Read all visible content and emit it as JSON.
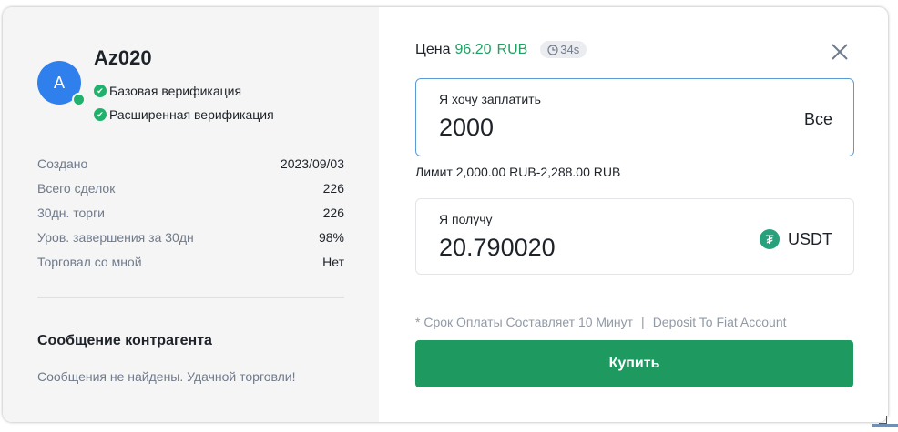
{
  "counterparty": {
    "avatar_letter": "A",
    "username": "Az020",
    "verifications": [
      "Базовая верификация",
      "Расширенная верификация"
    ]
  },
  "stats": [
    {
      "label": "Создано",
      "value": "2023/09/03"
    },
    {
      "label": "Всего сделок",
      "value": "226"
    },
    {
      "label": "30дн. торги",
      "value": "226"
    },
    {
      "label": "Уров. завершения за 30дн",
      "value": "98%"
    },
    {
      "label": "Торговал со мной",
      "value": "Нет"
    }
  ],
  "message": {
    "title": "Сообщение контрагента",
    "text": "Сообщения не найдены. Удачной торговли!"
  },
  "price": {
    "label": "Цена",
    "value": "96.20",
    "currency": "RUB",
    "timer": "34s"
  },
  "pay": {
    "label": "Я хочу заплатить",
    "value": "2000",
    "all_label": "Все"
  },
  "limit_text": "Лимит 2,000.00 RUB-2,288.00 RUB",
  "receive": {
    "label": "Я получу",
    "value": "20.790020",
    "coin": "USDT"
  },
  "note": {
    "payment_term": "* Срок Оплаты Составляет 10 Минут",
    "separator": "|",
    "account": "Deposit To Fiat Account"
  },
  "buy_button": "Купить",
  "colors": {
    "accent_green": "#1e9a61",
    "price_green": "#20a062",
    "avatar_blue": "#2f80ed",
    "active_border": "#5b9bd5"
  },
  "icons": {
    "close": "close-icon",
    "timer": "clock-icon",
    "check": "check-icon",
    "coin": "tether-icon"
  }
}
